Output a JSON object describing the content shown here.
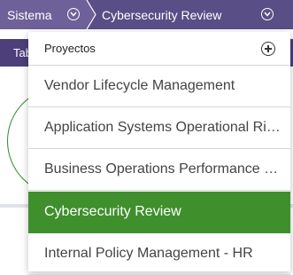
{
  "breadcrumb": {
    "first_label": "Sistema",
    "second_label": "Cybersecurity Review"
  },
  "background": {
    "tab_label": "Tab"
  },
  "dropdown": {
    "title": "Proyectos",
    "items": [
      {
        "label": "Vendor Lifecycle Management",
        "selected": false
      },
      {
        "label": "Application Systems Operational Risk...",
        "selected": false
      },
      {
        "label": "Business Operations Performance Ma...",
        "selected": false
      },
      {
        "label": "Cybersecurity Review",
        "selected": true
      },
      {
        "label": "Internal Policy Management - HR",
        "selected": false
      }
    ]
  },
  "colors": {
    "header_bar": "#5a4e86",
    "selected_item": "#3f8f2c"
  }
}
